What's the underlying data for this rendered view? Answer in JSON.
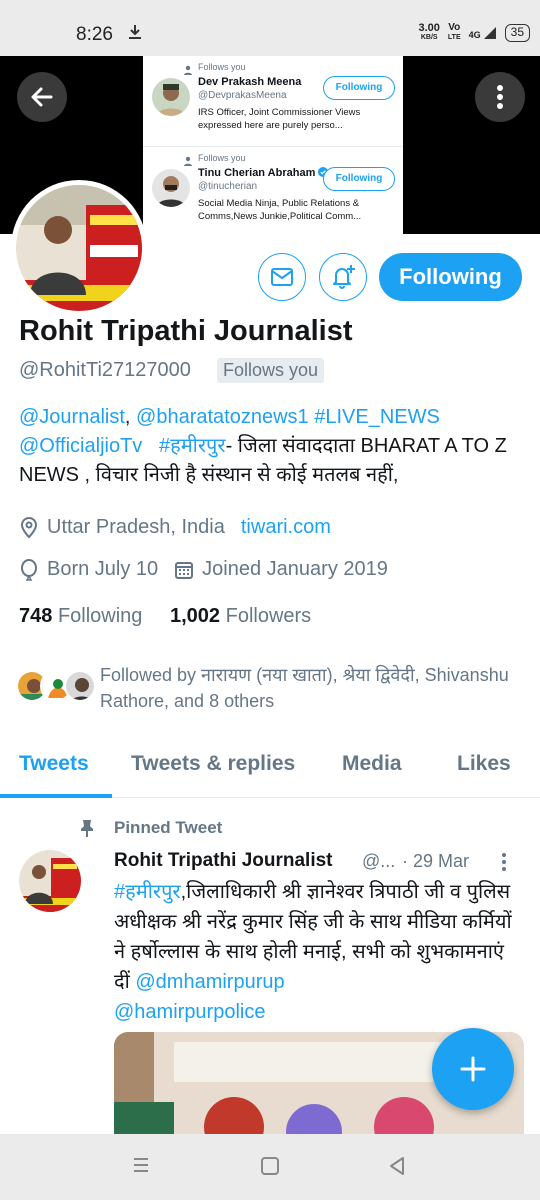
{
  "status_bar": {
    "time": "8:26",
    "speed_value": "3.00",
    "speed_unit": "KB/S",
    "net_volte": "Vo",
    "net_lte": "LTE",
    "net_type": "4G",
    "battery": "35"
  },
  "banner": {
    "cards": [
      {
        "follows_label": "Follows you",
        "name": "Dev Prakash Meena",
        "handle": "@DevprakasMeena",
        "bio": "IRS Officer, Joint Commissioner Views expressed here are purely perso...",
        "button": "Following"
      },
      {
        "follows_label": "Follows you",
        "name": "Tinu Cherian Abraham",
        "handle": "@tinucherian",
        "bio": "Social Media Ninja, Public Relations & Comms,News Junkie,Political Comm...",
        "button": "Following"
      }
    ]
  },
  "profile": {
    "name": "Rohit Tripathi Journalist",
    "handle": "@RohitTi27127000",
    "follows_you": "Follows you",
    "following_button": "Following",
    "bio_links": [
      "@Journalist",
      "@bharatatoznews1",
      "#LIVE_NEWS",
      "@OfficialjioTv",
      "#हमीरपुर"
    ],
    "bio_sep1": ", ",
    "bio_sep2": " ",
    "bio_text": "- जिला संवाददाता BHARAT A TO Z NEWS , विचार निजी है संस्थान से कोई मतलब नहीं,",
    "location": "Uttar Pradesh, India",
    "website": "tiwari.com",
    "birthday": "Born July 10",
    "joined": "Joined January 2019",
    "following_count": "748",
    "following_label": "Following",
    "followers_count": "1,002",
    "followers_label": "Followers",
    "followed_by": "Followed by नारायण (नया खाता), श्रेया द्विवेदी, Shivanshu Rathore, and 8 others"
  },
  "tabs": [
    {
      "label": "Tweets",
      "active": true
    },
    {
      "label": "Tweets & replies",
      "active": false
    },
    {
      "label": "Media",
      "active": false
    },
    {
      "label": "Likes",
      "active": false
    }
  ],
  "pinned_tweet": {
    "pinned_label": "Pinned Tweet",
    "name": "Rohit Tripathi Journalist",
    "handle": "@...",
    "date": "· 29 Mar",
    "hashtag": "#हमीरपुर",
    "text": ",जिलाधिकारी श्री ज्ञानेश्वर त्रिपाठी जी व पुलिस अधीक्षक श्री नरेंद्र कुमार सिंह जी के साथ मीडिया कर्मियों ने हर्षोल्लास के साथ होली मनाई, सभी को शुभकामनाएं दीं ",
    "mention1": "@dmhamirpurup",
    "mention2": "@hamirpurpolice"
  },
  "colors": {
    "accent": "#1da1f2",
    "secondary_text": "#657786"
  },
  "icons": {
    "back": "arrow-left-icon",
    "more": "more-vertical-icon",
    "mail": "mail-icon",
    "notify": "bell-plus-icon",
    "location": "location-pin-icon",
    "birthday": "balloon-icon",
    "joined": "calendar-icon",
    "pin": "pin-icon",
    "compose": "plus-icon"
  }
}
